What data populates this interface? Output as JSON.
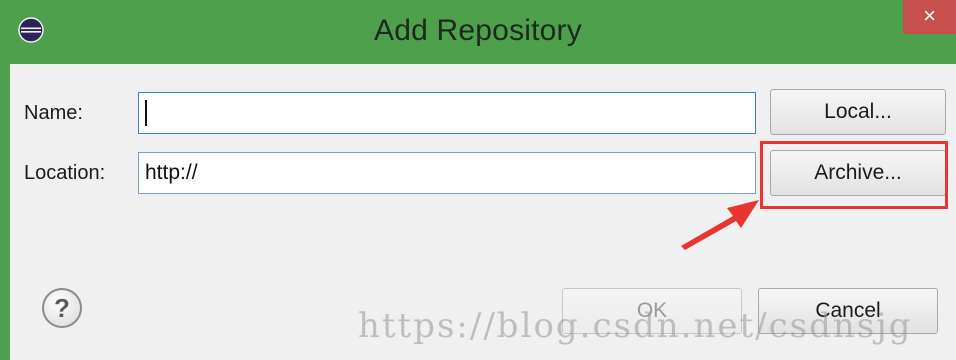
{
  "window": {
    "title": "Add Repository",
    "close_glyph": "×",
    "app_icon": "eclipse-icon"
  },
  "form": {
    "name_label": "Name:",
    "name_value": "",
    "location_label": "Location:",
    "location_value": "http://"
  },
  "buttons": {
    "local": "Local...",
    "archive": "Archive...",
    "ok": "OK",
    "cancel": "Cancel",
    "help_glyph": "?"
  },
  "annotation": {
    "color": "#e8362e",
    "target": "archive-button"
  },
  "watermark": "https://blog.csdn.net/csdnsjg"
}
